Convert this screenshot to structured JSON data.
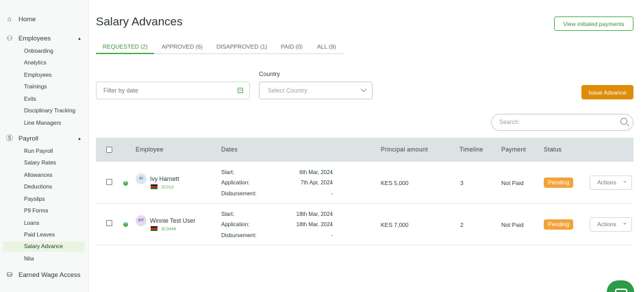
{
  "sidebar": {
    "home": "Home",
    "employees": {
      "label": "Employees",
      "items": [
        "Onboarding",
        "Analytics",
        "Employees",
        "Trainings",
        "Exits",
        "Disciplinary Tracking",
        "Line Managers"
      ]
    },
    "payroll": {
      "label": "Payroll",
      "items": [
        "Run Payroll",
        "Salary Rates",
        "Allowances",
        "Deductions",
        "Payslips",
        "P9 Forms",
        "Loans",
        "Paid Leaves",
        "Salary Advance",
        "Nita"
      ],
      "active_item": "Salary Advance"
    },
    "earned_wage": "Earned Wage Access"
  },
  "header": {
    "title": "Salary Advances",
    "view_initiated_label": "View initiated payments"
  },
  "tabs": [
    {
      "label": "REQUESTED (2)",
      "active": true
    },
    {
      "label": "APPROVED (6)",
      "active": false
    },
    {
      "label": "DISAPPROVED (1)",
      "active": false
    },
    {
      "label": "PAID (0)",
      "active": false
    },
    {
      "label": "ALL (9)",
      "active": false
    }
  ],
  "filters": {
    "date_placeholder": "Filter by date",
    "country_label": "Country",
    "country_placeholder": "Select Country",
    "issue_advance_label": "Issue Advance",
    "search_placeholder": "Search:"
  },
  "table": {
    "columns": [
      "Employee",
      "Dates",
      "Principal amount",
      "Timeline",
      "Payment",
      "Status"
    ],
    "date_labels": {
      "start": "Start:",
      "application": "Application:",
      "disbursement": "Disbursement:"
    },
    "actions_label": "Actions",
    "rows": [
      {
        "initials": "IH",
        "name": "Ivy Harnett",
        "id": "JC013",
        "start": "6th Mar, 2024",
        "application": "7th Apr, 2024",
        "disbursement": "-",
        "principal": "KES 5,000",
        "timeline": "3",
        "payment": "Not Paid",
        "status": "Pending"
      },
      {
        "initials": "WT",
        "name": "Winnie Test User",
        "id": "JC3446",
        "start": "18th Mar, 2024",
        "application": "18th Mar, 2024",
        "disbursement": "-",
        "principal": "KES 7,000",
        "timeline": "2",
        "payment": "Not Paid",
        "status": "Pending"
      }
    ]
  },
  "colors": {
    "accent_green": "#4caf50",
    "issue_button": "#de8d0b",
    "pending_badge": "#f2a33a",
    "table_header": "#dce3e5"
  }
}
